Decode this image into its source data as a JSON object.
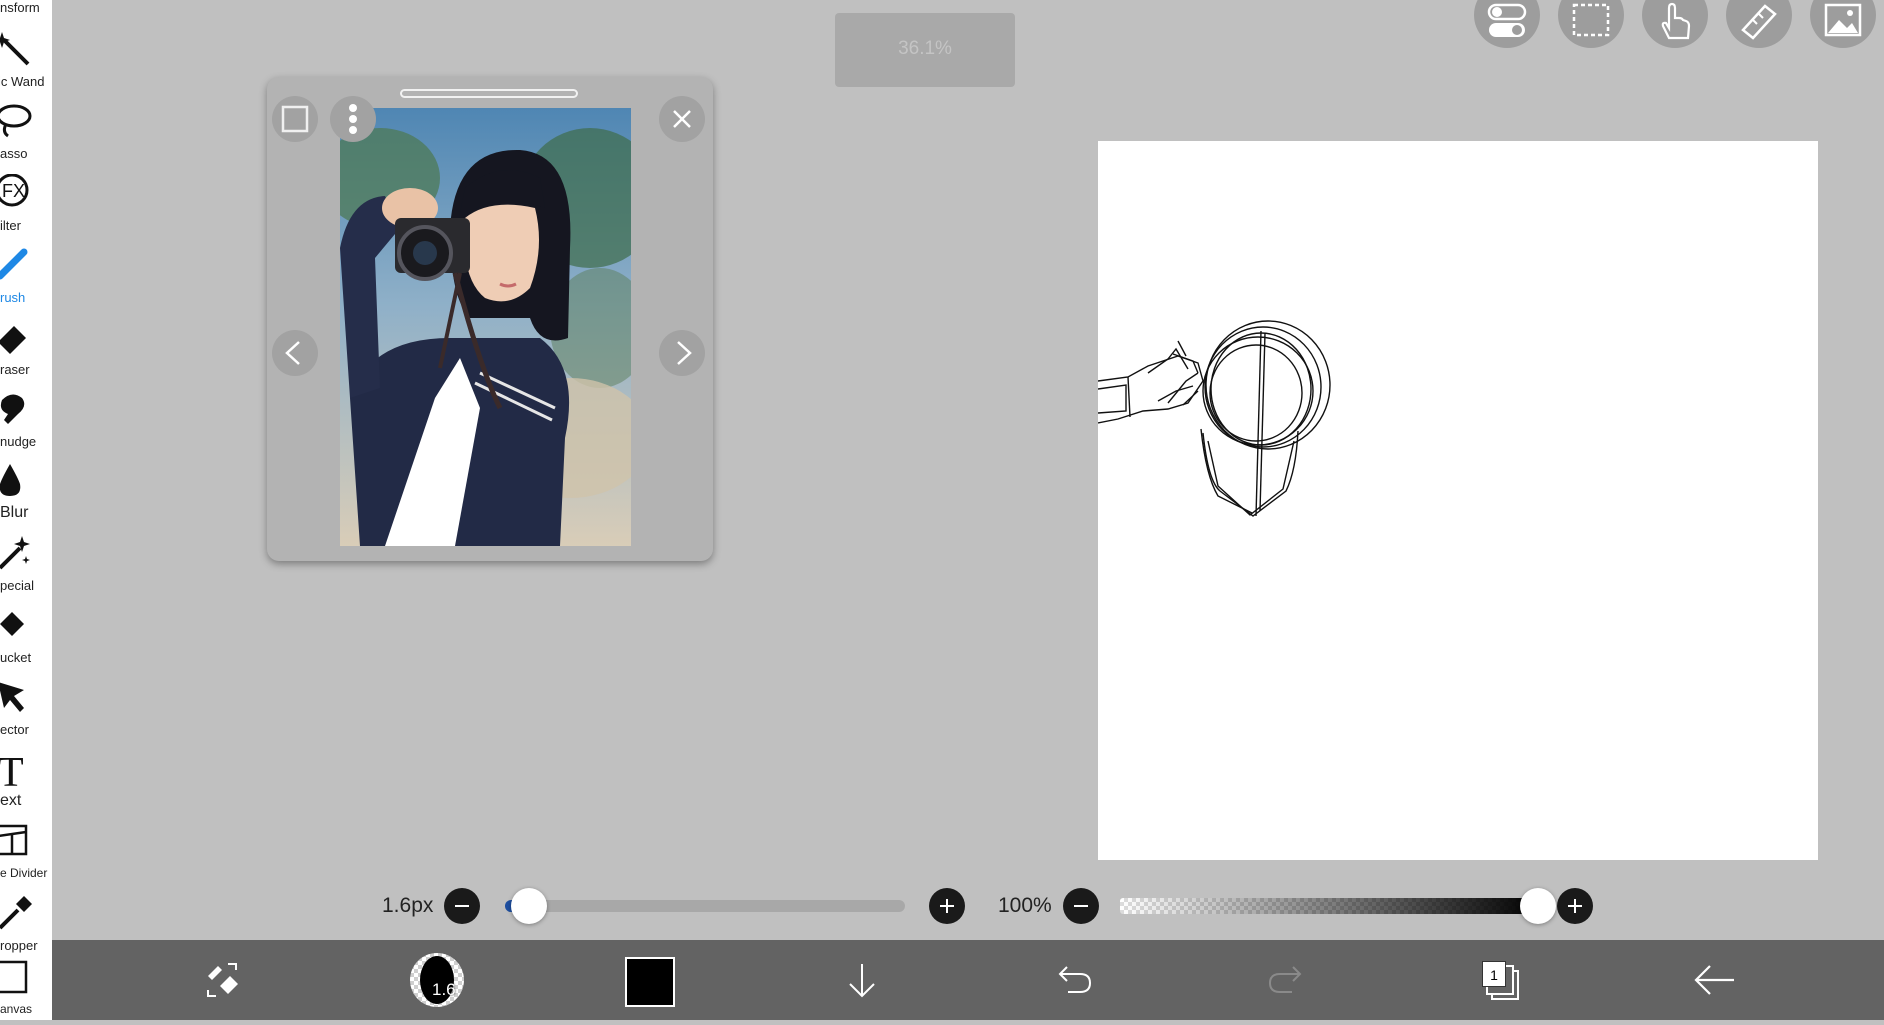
{
  "toolbar": {
    "tools": [
      {
        "label": "nsform",
        "icon": "transform-icon"
      },
      {
        "label": "ic Wand",
        "icon": "magic-wand-icon"
      },
      {
        "label": "asso",
        "icon": "lasso-icon"
      },
      {
        "label": "ilter",
        "icon": "filter-fx-icon"
      },
      {
        "label": "rush",
        "icon": "brush-icon",
        "active": true
      },
      {
        "label": "raser",
        "icon": "eraser-icon"
      },
      {
        "label": "nudge",
        "icon": "smudge-icon"
      },
      {
        "label": "Blur",
        "icon": "blur-drop-icon"
      },
      {
        "label": "pecial",
        "icon": "special-wand-icon"
      },
      {
        "label": "ucket",
        "icon": "bucket-icon"
      },
      {
        "label": "ector",
        "icon": "selector-arrow-icon"
      },
      {
        "label": "ext",
        "icon": "text-t-icon"
      },
      {
        "label": "e Divider",
        "icon": "frame-divider-icon"
      },
      {
        "label": "ropper",
        "icon": "eyedropper-icon"
      },
      {
        "label": "anvas",
        "icon": "canvas-icon"
      }
    ]
  },
  "zoom": {
    "value": "36.1%"
  },
  "top_buttons": [
    "toggle-icon",
    "selection-icon",
    "hand-icon",
    "ruler-icon",
    "image-icon"
  ],
  "reference_panel": {
    "image_description": "reference photo"
  },
  "brush": {
    "size_label": "1.6px",
    "size_fraction": 0.04,
    "opacity_label": "100%",
    "opacity_fraction": 1.0,
    "preview_number": "1.6"
  },
  "color": {
    "current": "#000000",
    "accent": "#1e88e5"
  },
  "bottom_bar": {
    "layer_count": "1",
    "icons": [
      "swap-tools-icon",
      "brush-preview",
      "color-swatch",
      "download-arrow-icon",
      "undo-icon",
      "redo-icon",
      "layers-icon",
      "back-arrow-icon"
    ]
  }
}
